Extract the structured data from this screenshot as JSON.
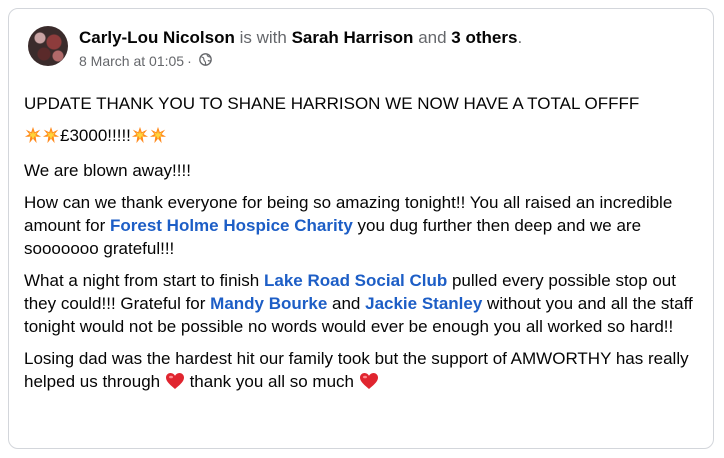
{
  "post": {
    "author": "Carly-Lou Nicolson",
    "with_text": "is with",
    "tagged": "Sarah Harrison",
    "and_text": "and",
    "others": "3 others",
    "period": ".",
    "timestamp": "8 March at 01:05",
    "separator": "·",
    "privacy_icon": "globe-icon",
    "p1": "UPDATE THANK YOU TO SHANE HARRISON WE NOW HAVE A TOTAL OFFFF",
    "p2_amount": "£3000!!!!!",
    "p2_emoji": "collision-icon",
    "p3": "We are blown away!!!!",
    "p4_a": "How can we thank everyone for being so amazing tonight!! You all raised an incredible amount for ",
    "p4_link": "Forest Holme Hospice Charity",
    "p4_b": " you dug further then deep and we are sooooooo grateful!!!",
    "p5_a": "What a night from start to finish ",
    "p5_link1": "Lake Road Social Club",
    "p5_b": " pulled every possible stop out they could!!! Grateful for ",
    "p5_link2": "Mandy Bourke",
    "p5_c": " and ",
    "p5_link3": "Jackie Stanley",
    "p5_d": " without you and all the staff tonight would not be possible no words would ever be enough you all worked so hard!!",
    "p6_a": "Losing dad was the hardest hit our family took but the support of AMWORTHY has really helped us through ",
    "p6_b": " thank you all so much ",
    "heart_emoji": "red-heart-icon",
    "colors": {
      "link": "#1d5ec6",
      "meta": "#65676b",
      "text": "#050505",
      "border": "#d3d6db"
    }
  }
}
